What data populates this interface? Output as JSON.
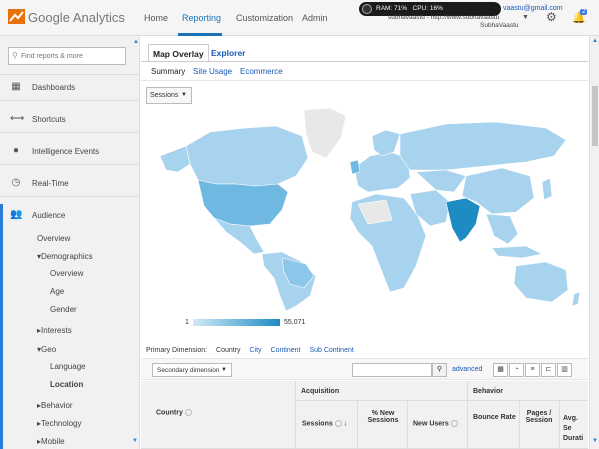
{
  "header": {
    "brand": "Google Analytics",
    "nav": [
      "Home",
      "Reporting",
      "Customization",
      "Admin"
    ],
    "active_nav": "Reporting",
    "perf": {
      "ram": "RAM: 71%",
      "cpu": "CPU: 16%"
    },
    "email": "vaastu@gmail.com",
    "account_line": "subhavaastu - http://www.subhavaastu",
    "account_name": "SubhaVaastu",
    "notification_count": "2"
  },
  "sidebar": {
    "search_placeholder": "Find reports & more",
    "main": [
      "Dashboards",
      "Shortcuts",
      "Intelligence Events",
      "Real-Time",
      "Audience"
    ],
    "sub": [
      "Overview",
      "Demographics",
      "Overview",
      "Age",
      "Gender",
      "Interests",
      "Geo",
      "Language",
      "Location",
      "Behavior",
      "Technology",
      "Mobile"
    ]
  },
  "tabs": [
    "Map Overlay",
    "Explorer"
  ],
  "subtabs": [
    "Summary",
    "Site Usage",
    "Ecommerce"
  ],
  "metric_selector": "Sessions",
  "legend": {
    "min": "1",
    "max": "55,071"
  },
  "primary_dimension": {
    "label": "Primary Dimension:",
    "current": "Country",
    "options": [
      "City",
      "Continent",
      "Sub Continent"
    ]
  },
  "table_toolbar": {
    "secondary_dimension": "Secondary dimension",
    "advanced": "advanced"
  },
  "table_header": {
    "groups": [
      "Acquisition",
      "Behavior"
    ],
    "country": "Country",
    "columns": [
      "Sessions",
      "% New Sessions",
      "New Users",
      "Bounce Rate",
      "Pages / Session",
      "Avg. Se Durati"
    ]
  },
  "colors": {
    "accent": "#2b7bd8",
    "map_max": "#1e8bc3",
    "map_low": "#a8d3ee",
    "map_none": "#e8e8e8"
  }
}
